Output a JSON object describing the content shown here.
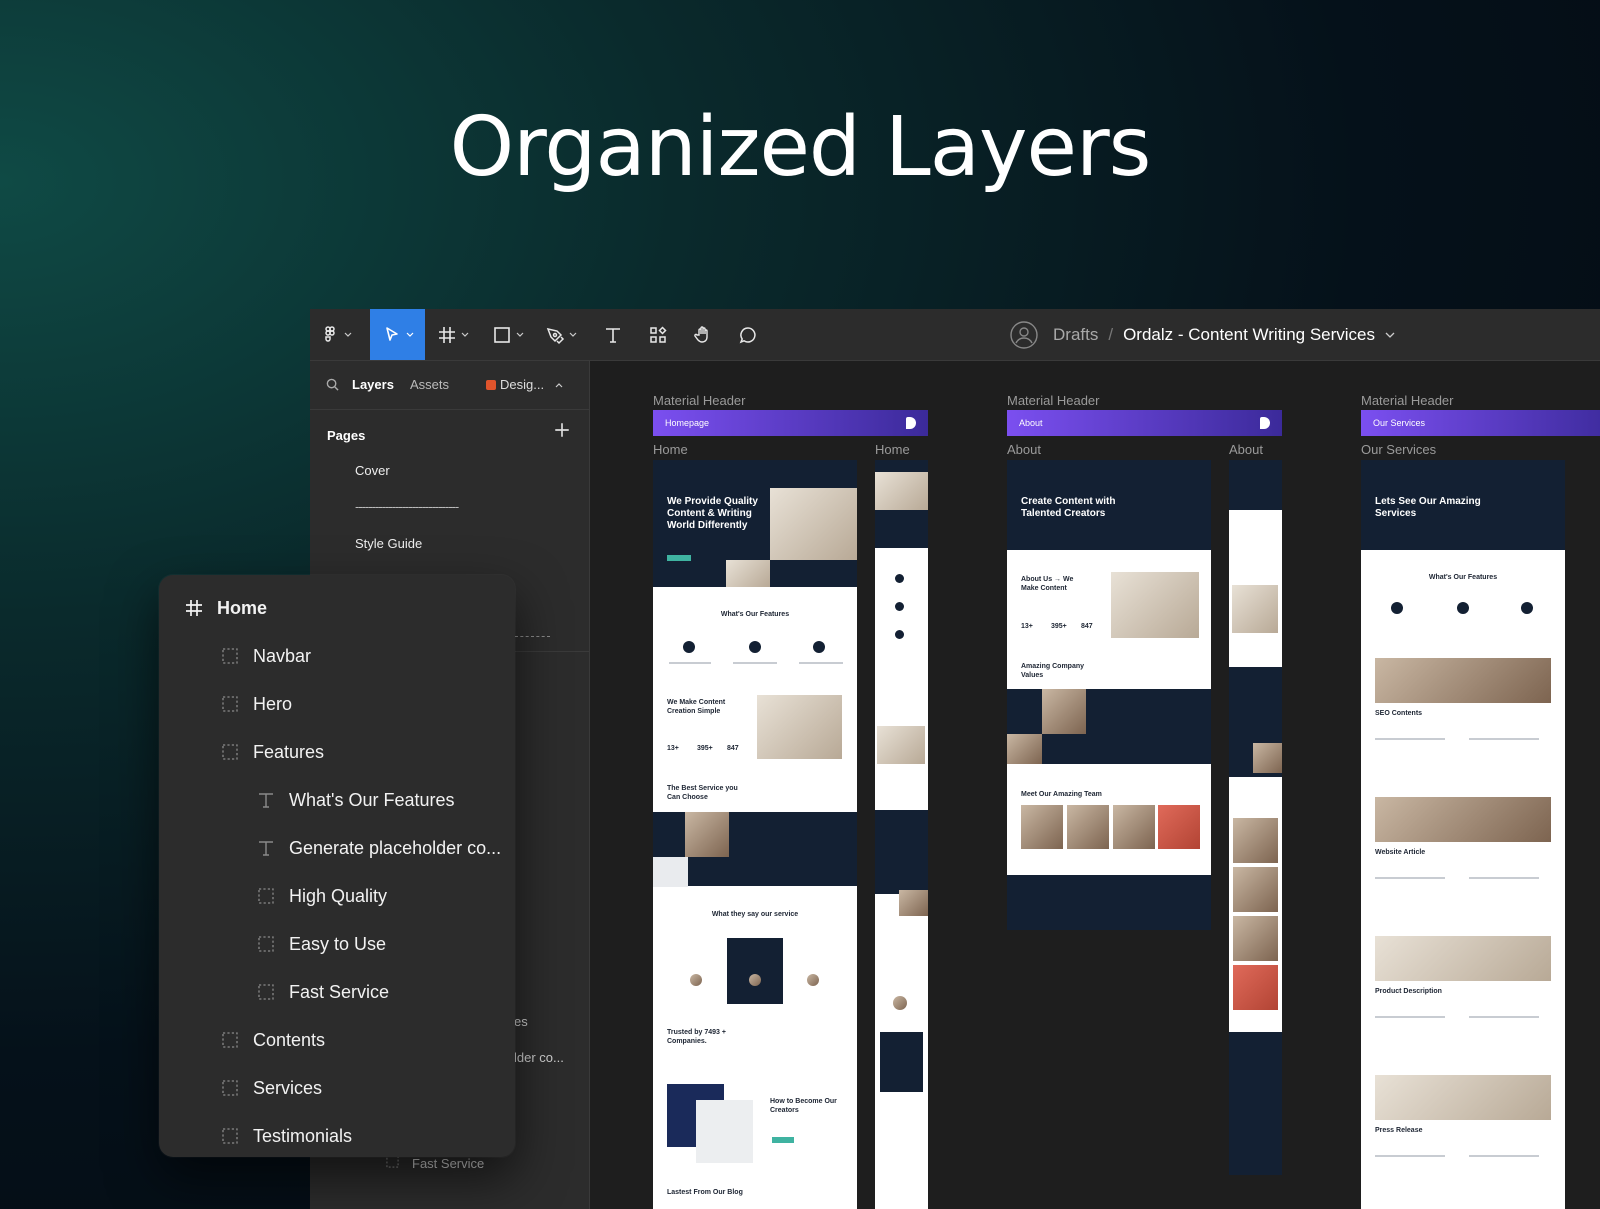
{
  "hero": {
    "title": "Organized Layers"
  },
  "toolbar": {
    "tools": [
      "figma-menu",
      "move-tool",
      "frame-tool",
      "shape-tool",
      "pen-tool",
      "text-tool",
      "components-tool",
      "hand-tool",
      "comment-tool"
    ],
    "active_tool": "move-tool",
    "breadcrumb": {
      "root": "Drafts",
      "separator": "/",
      "file": "Ordalz - Content Writing Services"
    }
  },
  "left_panel": {
    "tabs": {
      "layers": "Layers",
      "assets": "Assets",
      "design": "Desig..."
    },
    "pages_heading": "Pages",
    "pages": [
      "Cover",
      "-------------------------------",
      "Style Guide"
    ],
    "stray_labels": [
      "es",
      "lder co...",
      "Fast Service"
    ]
  },
  "canvas": {
    "frames": [
      {
        "group_label": "Material Header",
        "header_title": "Homepage",
        "desktop_label": "Home",
        "mobile_label": "Home",
        "hero_text": "We Provide Quality Content & Writing World Differently",
        "section_features": "What's Our Features",
        "section_creation": "We Make Content Creation Simple",
        "stats": [
          "13+",
          "395+",
          "847"
        ],
        "section_service": "The Best Service you Can Choose",
        "section_testimonial": "What they say our service",
        "section_trusted": "Trusted by 7493 + Companies.",
        "section_creators": "How to Become Our Creators",
        "section_blog": "Lastest From Our Blog"
      },
      {
        "group_label": "Material Header",
        "header_title": "About",
        "desktop_label": "About",
        "mobile_label": "About",
        "hero_text": "Create Content with Talented Creators",
        "section_about": "About Us → We Make Content",
        "stats": [
          "13+",
          "395+",
          "847"
        ],
        "section_values": "Amazing Company Values",
        "section_team": "Meet Our Amazing Team"
      },
      {
        "group_label": "Material Header",
        "header_title": "Our Services",
        "desktop_label": "Our Services",
        "hero_text": "Lets See Our Amazing Services",
        "section_features": "What's Our Features",
        "services": [
          "SEO Contents",
          "Website Article",
          "Product Description",
          "Press Release"
        ]
      }
    ]
  },
  "layers_panel": {
    "root": "Home",
    "items": [
      {
        "label": "Navbar",
        "type": "frame",
        "level": 1
      },
      {
        "label": "Hero",
        "type": "frame",
        "level": 1
      },
      {
        "label": "Features",
        "type": "frame",
        "level": 1
      },
      {
        "label": "What's Our Features",
        "type": "text",
        "level": 2
      },
      {
        "label": "Generate placeholder co...",
        "type": "text",
        "level": 2
      },
      {
        "label": "High Quality",
        "type": "frame",
        "level": 2
      },
      {
        "label": "Easy to Use",
        "type": "frame",
        "level": 2
      },
      {
        "label": "Fast Service",
        "type": "frame",
        "level": 2
      },
      {
        "label": "Contents",
        "type": "frame",
        "level": 1
      },
      {
        "label": "Services",
        "type": "frame",
        "level": 1
      },
      {
        "label": "Testimonials",
        "type": "frame",
        "level": 1
      }
    ]
  },
  "colors": {
    "active_tool": "#2f7fe6",
    "header_gradient_start": "#7b4ff0",
    "header_gradient_end": "#3b2a9a",
    "dark_navy": "#132033",
    "teal_accent": "#3fb3a1"
  }
}
